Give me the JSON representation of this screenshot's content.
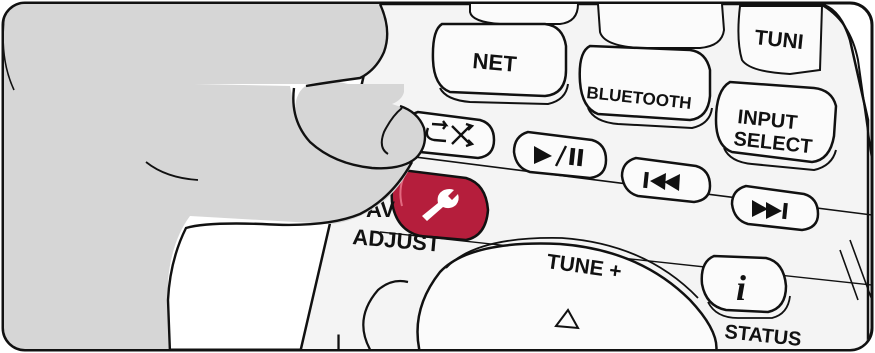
{
  "buttons": {
    "net": "NET",
    "bluetooth": "BLUETOOTH",
    "tune_top": "TUNI",
    "input_select_line1": "INPUT",
    "input_select_line2": "SELECT"
  },
  "labels": {
    "av": "AV",
    "adjust": "ADJUST",
    "tune_plus": "TUNE +",
    "status": "STATUS",
    "info_glyph": "i"
  },
  "icons": {
    "repeat_shuffle": "repeat-shuffle-icon",
    "play_pause": "play-pause-icon",
    "previous": "previous-track-icon",
    "next": "next-track-icon",
    "wrench": "wrench-icon",
    "tune_up": "up-triangle-icon"
  },
  "colors": {
    "av_adjust_button": "#b51e3c",
    "remote_body": "#f2f2f2",
    "hand": "#d6d6d6",
    "outline": "#111111"
  }
}
